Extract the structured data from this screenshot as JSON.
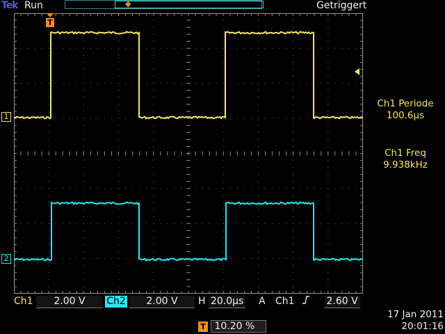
{
  "header": {
    "brand": "Tek",
    "acq_state": "Run",
    "trigger_status": "Getriggert"
  },
  "channels": {
    "ch1": {
      "marker": "1",
      "color": "#f4e66a"
    },
    "ch2": {
      "marker": "2",
      "color": "#28e6f0"
    }
  },
  "trigger_marker": "T",
  "measurements": [
    {
      "label": "Ch1 Periode",
      "value": "100.6µs"
    },
    {
      "label": "Ch1 Freq",
      "value": "9.938kHz"
    }
  ],
  "status_bar": {
    "ch1_label": "Ch1",
    "ch1_scale": "2.00 V",
    "ch2_label": "Ch2",
    "ch2_scale": "2.00 V",
    "horizontal_label": "H",
    "horizontal_scale": "20.0µs",
    "trigger_mode": "A",
    "trigger_source": "Ch1",
    "trigger_slope_icon": "rising-edge-icon",
    "trigger_level": "2.60 V",
    "trigger_position_icon": "T",
    "trigger_position": "10.20 %",
    "date": "17 Jan  2011",
    "time": "20:01:16"
  },
  "colors": {
    "ch1": "#f4e66a",
    "ch2": "#28e6f0",
    "trigger": "#ff8a1e",
    "grid": "#6a6a6a",
    "background": "#000000"
  }
}
